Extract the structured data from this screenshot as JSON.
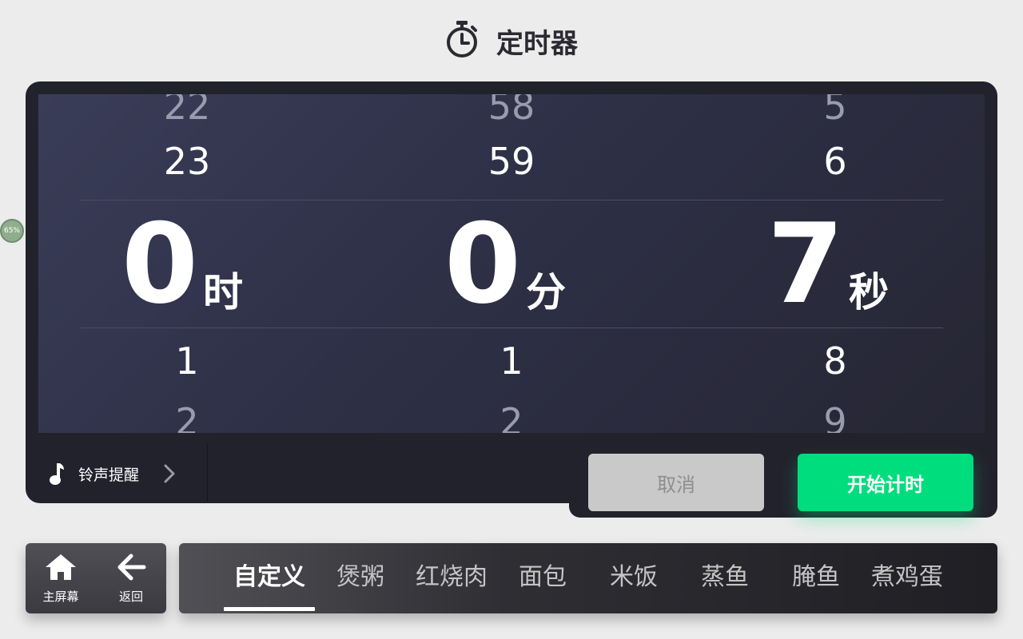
{
  "header": {
    "title": "定时器",
    "icon": "stopwatch-icon"
  },
  "picker": {
    "hours": {
      "above2": "22",
      "above1": "23",
      "selected": "0",
      "unit": "时",
      "below1": "1",
      "below2": "2"
    },
    "minutes": {
      "above2": "58",
      "above1": "59",
      "selected": "0",
      "unit": "分",
      "below1": "1",
      "below2": "2"
    },
    "seconds": {
      "above2": "5",
      "above1": "6",
      "selected": "7",
      "unit": "秒",
      "below1": "8",
      "below2": "9"
    }
  },
  "ringtone": {
    "label": "铃声提醒",
    "icon": "music-note-icon",
    "chevron": "chevron-right-icon"
  },
  "actions": {
    "cancel_label": "取消",
    "start_label": "开始计时"
  },
  "nav": {
    "home_label": "主屏幕",
    "home_icon": "home-icon",
    "back_label": "返回",
    "back_icon": "arrow-left-icon"
  },
  "tabs": {
    "items": [
      "自定义",
      "煲粥",
      "红烧肉",
      "面包",
      "米饭",
      "蒸鱼",
      "腌鱼",
      "煮鸡蛋"
    ],
    "active_index": 0
  },
  "badge": {
    "text": "65%"
  },
  "colors": {
    "accent_green": "#00dd7c",
    "panel_dark": "#22222c",
    "cancel_gray": "#c9c9c9",
    "background": "#ececec"
  }
}
